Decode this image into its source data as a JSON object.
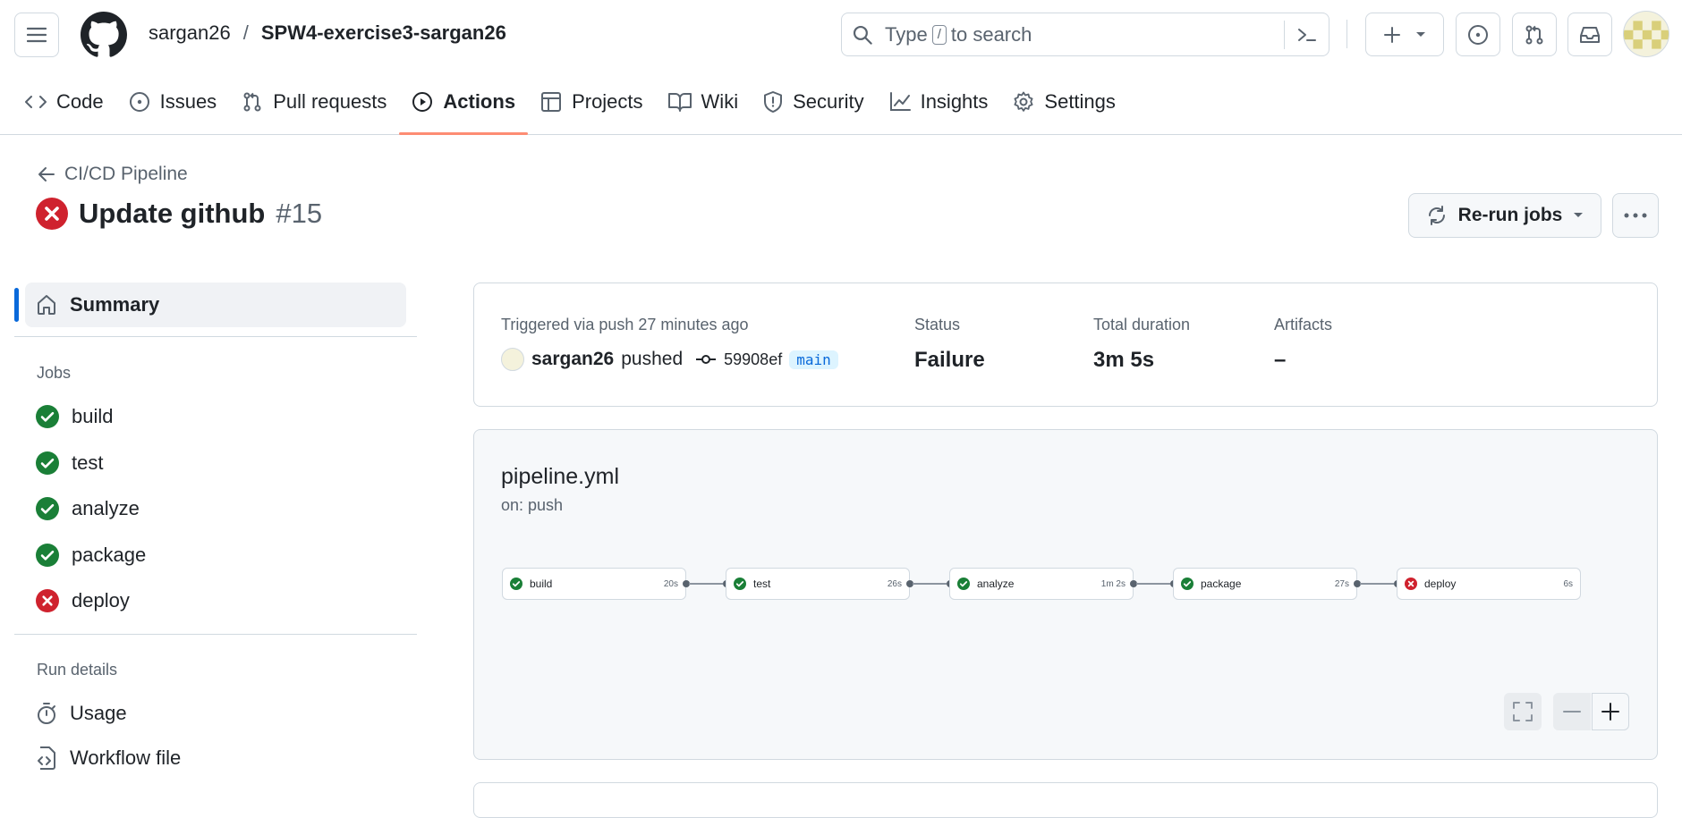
{
  "header": {
    "owner": "sargan26",
    "separator": "/",
    "repo": "SPW4-exercise3-sargan26",
    "search": {
      "prefix": "Type",
      "key": "/",
      "suffix": "to search"
    }
  },
  "tabs": [
    {
      "label": "Code",
      "icon": "code-icon"
    },
    {
      "label": "Issues",
      "icon": "issue-icon"
    },
    {
      "label": "Pull requests",
      "icon": "pull-request-icon"
    },
    {
      "label": "Actions",
      "icon": "play-icon",
      "active": true
    },
    {
      "label": "Projects",
      "icon": "table-icon"
    },
    {
      "label": "Wiki",
      "icon": "book-icon"
    },
    {
      "label": "Security",
      "icon": "shield-icon"
    },
    {
      "label": "Insights",
      "icon": "graph-icon"
    },
    {
      "label": "Settings",
      "icon": "gear-icon"
    }
  ],
  "run": {
    "back_label": "CI/CD Pipeline",
    "title": "Update github",
    "number": "#15",
    "status": "failure",
    "rerun_label": "Re-run jobs"
  },
  "sidebar": {
    "summary_label": "Summary",
    "jobs_heading": "Jobs",
    "jobs": [
      {
        "name": "build",
        "status": "success"
      },
      {
        "name": "test",
        "status": "success"
      },
      {
        "name": "analyze",
        "status": "success"
      },
      {
        "name": "package",
        "status": "success"
      },
      {
        "name": "deploy",
        "status": "failure"
      }
    ],
    "run_details_heading": "Run details",
    "usage_label": "Usage",
    "workflow_file_label": "Workflow file"
  },
  "summary": {
    "trigger_text": "Triggered via push 27 minutes ago",
    "actor": "sargan26",
    "action": "pushed",
    "commit": "59908ef",
    "branch": "main",
    "status_label": "Status",
    "status_value": "Failure",
    "duration_label": "Total duration",
    "duration_value": "3m 5s",
    "artifacts_label": "Artifacts",
    "artifacts_value": "–"
  },
  "workflow": {
    "file": "pipeline.yml",
    "on": "on: push",
    "nodes": [
      {
        "name": "build",
        "duration": "20s",
        "status": "success"
      },
      {
        "name": "test",
        "duration": "26s",
        "status": "success"
      },
      {
        "name": "analyze",
        "duration": "1m 2s",
        "status": "success"
      },
      {
        "name": "package",
        "duration": "27s",
        "status": "success"
      },
      {
        "name": "deploy",
        "duration": "6s",
        "status": "failure"
      }
    ]
  },
  "colors": {
    "success": "#1a7f37",
    "failure": "#cf222e",
    "accent": "#0969da",
    "tab_underline": "#fd8c73"
  }
}
